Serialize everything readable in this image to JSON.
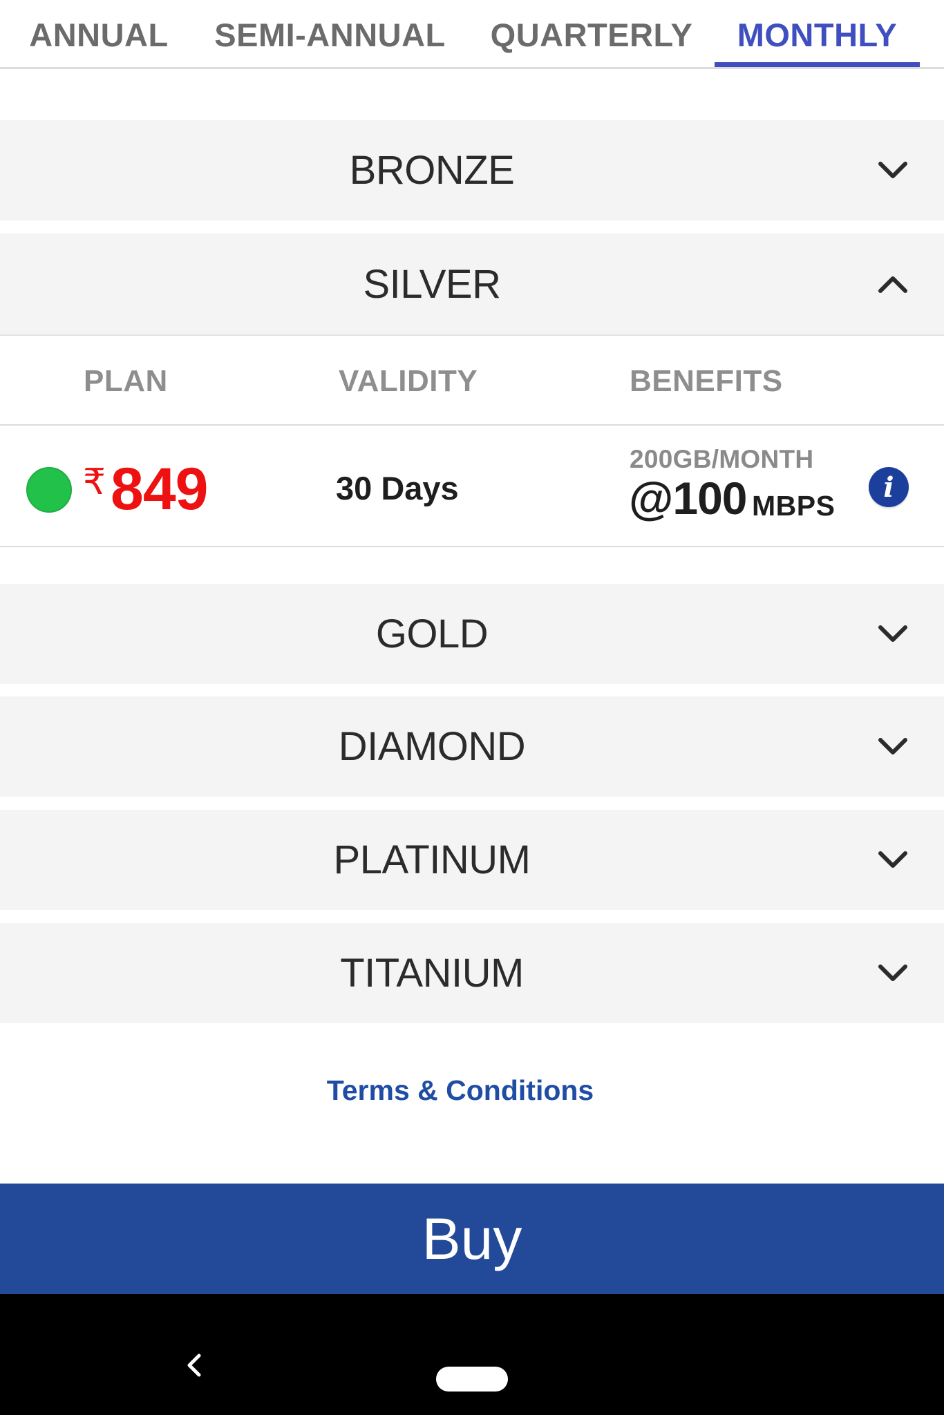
{
  "tabs": [
    {
      "label": "ANNUAL",
      "active": false
    },
    {
      "label": "SEMI-ANNUAL",
      "active": false
    },
    {
      "label": "QUARTERLY",
      "active": false
    },
    {
      "label": "MONTHLY",
      "active": true
    }
  ],
  "accordion": [
    {
      "title": "BRONZE",
      "expanded": false
    },
    {
      "title": "SILVER",
      "expanded": true
    },
    {
      "title": "GOLD",
      "expanded": false
    },
    {
      "title": "DIAMOND",
      "expanded": false
    },
    {
      "title": "PLATINUM",
      "expanded": false
    },
    {
      "title": "TITANIUM",
      "expanded": false
    }
  ],
  "silver_plan": {
    "headers": {
      "plan": "PLAN",
      "validity": "VALIDITY",
      "benefits": "BENEFITS"
    },
    "currency_symbol": "₹",
    "price": "849",
    "validity": "30 Days",
    "data_allowance": "200GB/MONTH",
    "speed": "@100",
    "speed_unit": "MBPS",
    "selected": true,
    "info_icon": "i"
  },
  "links": {
    "terms": "Terms & Conditions"
  },
  "buy": {
    "label": "Buy"
  },
  "colors": {
    "accent": "#3f4fbf",
    "price": "#ee1111",
    "selected": "#22c14a",
    "buy_bg": "#224a98",
    "link": "#1f4da3",
    "info": "#1d3f9c"
  },
  "icons": {
    "expanded": "chevron-up-icon",
    "collapsed": "chevron-down-icon",
    "back": "back-arrow-icon",
    "home": "home-pill-icon",
    "info": "info-icon"
  }
}
